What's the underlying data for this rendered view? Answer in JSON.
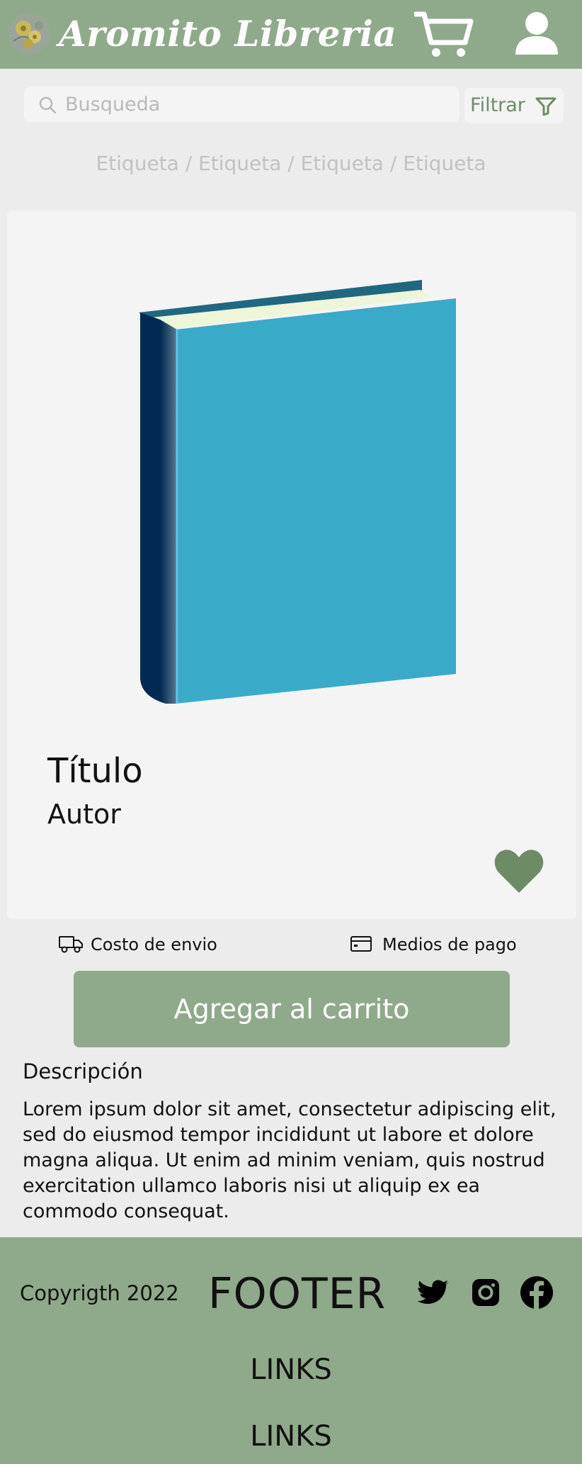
{
  "header": {
    "brand": "Aromito Libreria",
    "logo_icon": "flower-logo-icon",
    "cart_icon": "shopping-cart-icon",
    "user_icon": "user-profile-icon",
    "background_color": "#8faa8a"
  },
  "search": {
    "placeholder": "Busqueda",
    "value": "",
    "icon": "search-icon"
  },
  "filter": {
    "label": "Filtrar",
    "icon": "funnel-icon"
  },
  "breadcrumb": {
    "text": "Etiqueta / Etiqueta / Etiqueta / Etiqueta"
  },
  "product": {
    "title": "Título",
    "author": "Autor",
    "cover_color": "#3aaac9",
    "spine_color": "#002a52",
    "favorite_icon": "heart-icon",
    "favorite_color": "#6d8c66"
  },
  "info": {
    "shipping_label": "Costo de envio",
    "shipping_icon": "truck-icon",
    "payment_label": "Medios de pago",
    "payment_icon": "credit-card-icon"
  },
  "actions": {
    "add_to_cart": "Agregar al carrito"
  },
  "description": {
    "heading": "Descripción",
    "body": "Lorem ipsum dolor sit amet, consectetur adipiscing elit, sed do eiusmod tempor incididunt ut labore et dolore magna aliqua. Ut enim ad minim veniam, quis nostrud exercitation ullamco laboris nisi ut aliquip ex ea commodo consequat."
  },
  "footer": {
    "copyright": "Copyrigth 2022",
    "title": "FOOTER",
    "links": [
      "LINKS",
      "LINKS"
    ],
    "social_icons": [
      "twitter-icon",
      "instagram-icon",
      "facebook-icon"
    ]
  }
}
